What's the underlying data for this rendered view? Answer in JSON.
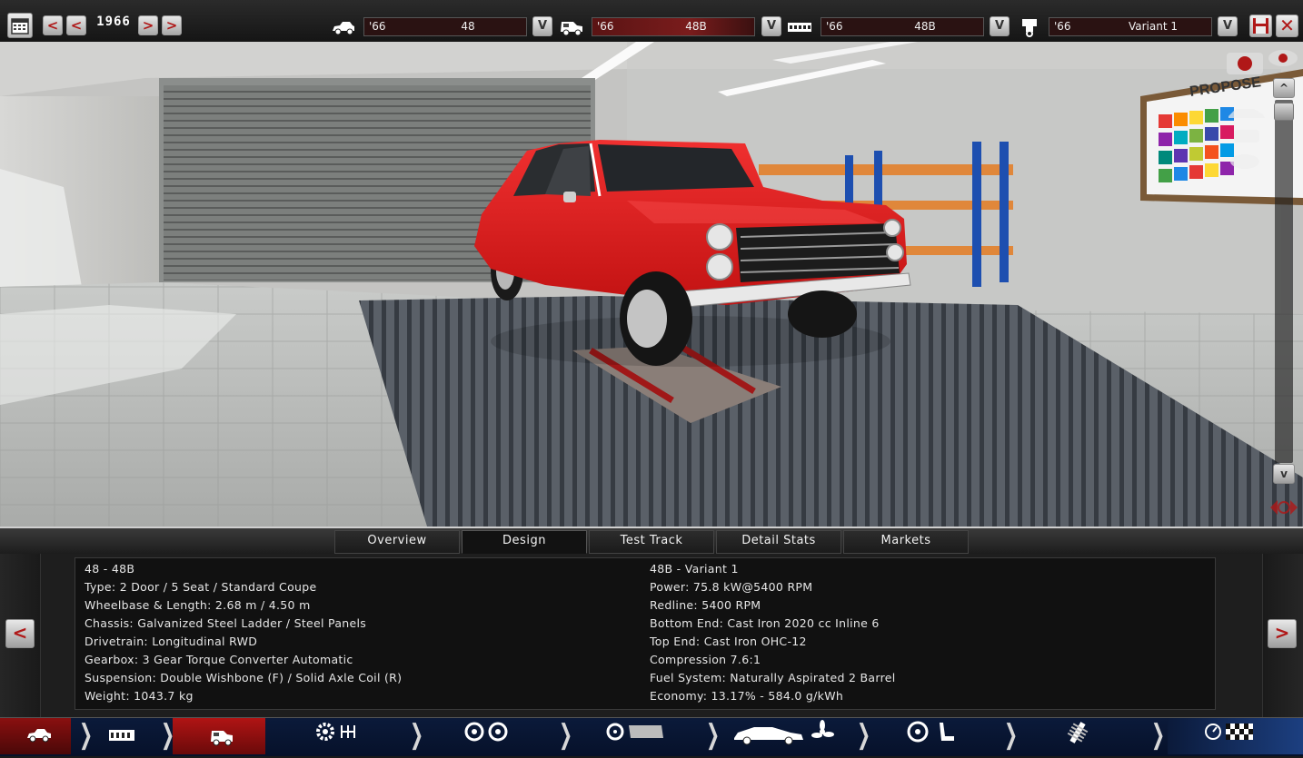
{
  "topbar": {
    "year": "1966",
    "model_selector": {
      "year": "'66",
      "name": "48"
    },
    "trim_selector": {
      "year": "'66",
      "name": "48B"
    },
    "engine_selector": {
      "year": "'66",
      "name": "48B"
    },
    "variant_selector": {
      "year": "'66",
      "name": "Variant 1"
    },
    "prev_label": "<",
    "next_label": ">",
    "dropdown_label": "V",
    "close_label": "✕"
  },
  "viewport": {
    "scene_sign": "PROPOSE",
    "scroll_up": "^",
    "scroll_down": "v"
  },
  "tabs": [
    {
      "label": "Overview"
    },
    {
      "label": "Design"
    },
    {
      "label": "Test Track"
    },
    {
      "label": "Detail Stats"
    },
    {
      "label": "Markets"
    }
  ],
  "active_tab": "Design",
  "info": {
    "left": [
      "48 - 48B",
      "Type: 2 Door / 5 Seat / Standard Coupe",
      "Wheelbase & Length: 2.68 m / 4.50 m",
      "Chassis: Galvanized Steel Ladder / Steel Panels",
      "Drivetrain: Longitudinal RWD",
      "Gearbox: 3 Gear Torque Converter Automatic",
      "Suspension: Double Wishbone (F) / Solid Axle Coil (R)",
      "Weight: 1043.7 kg"
    ],
    "right": [
      "48B - Variant 1",
      "Power: 75.8 kW@5400 RPM",
      "Redline: 5400 RPM",
      "Bottom End: Cast Iron 2020 cc Inline 6",
      "Top End: Cast Iron OHC-12",
      "Compression 7.6:1",
      "Fuel System: Naturally Aspirated 2 Barrel",
      "Economy: 13.17% - 584.0 g/kWh"
    ]
  },
  "bottom_nav": [
    {
      "name": "car-model",
      "icons": [
        "car-side-icon"
      ]
    },
    {
      "name": "chassis",
      "icons": [
        "chassis-frame-icon"
      ]
    },
    {
      "name": "trim-body",
      "icons": [
        "car-body-icon"
      ],
      "active": true
    },
    {
      "name": "engine-gearbox",
      "icons": [
        "gear-icon",
        "gearshift-icon"
      ]
    },
    {
      "name": "wheels-brakes",
      "icons": [
        "wheel-icon",
        "wheel-icon"
      ]
    },
    {
      "name": "tyres-brakes",
      "icons": [
        "tyre-icon",
        "brake-disc-icon"
      ]
    },
    {
      "name": "aero-cooling",
      "icons": [
        "sports-car-icon",
        "fan-icon"
      ]
    },
    {
      "name": "interior",
      "icons": [
        "steering-wheel-icon",
        "seat-icon"
      ]
    },
    {
      "name": "suspension",
      "icons": [
        "shock-absorber-icon"
      ]
    },
    {
      "name": "testing",
      "icons": [
        "gauge-icon",
        "checkered-flag-icon"
      ]
    }
  ],
  "colors": {
    "accent": "#b01818",
    "car_body": "#e01a1a",
    "nav_bg": "#0b1a3a"
  }
}
